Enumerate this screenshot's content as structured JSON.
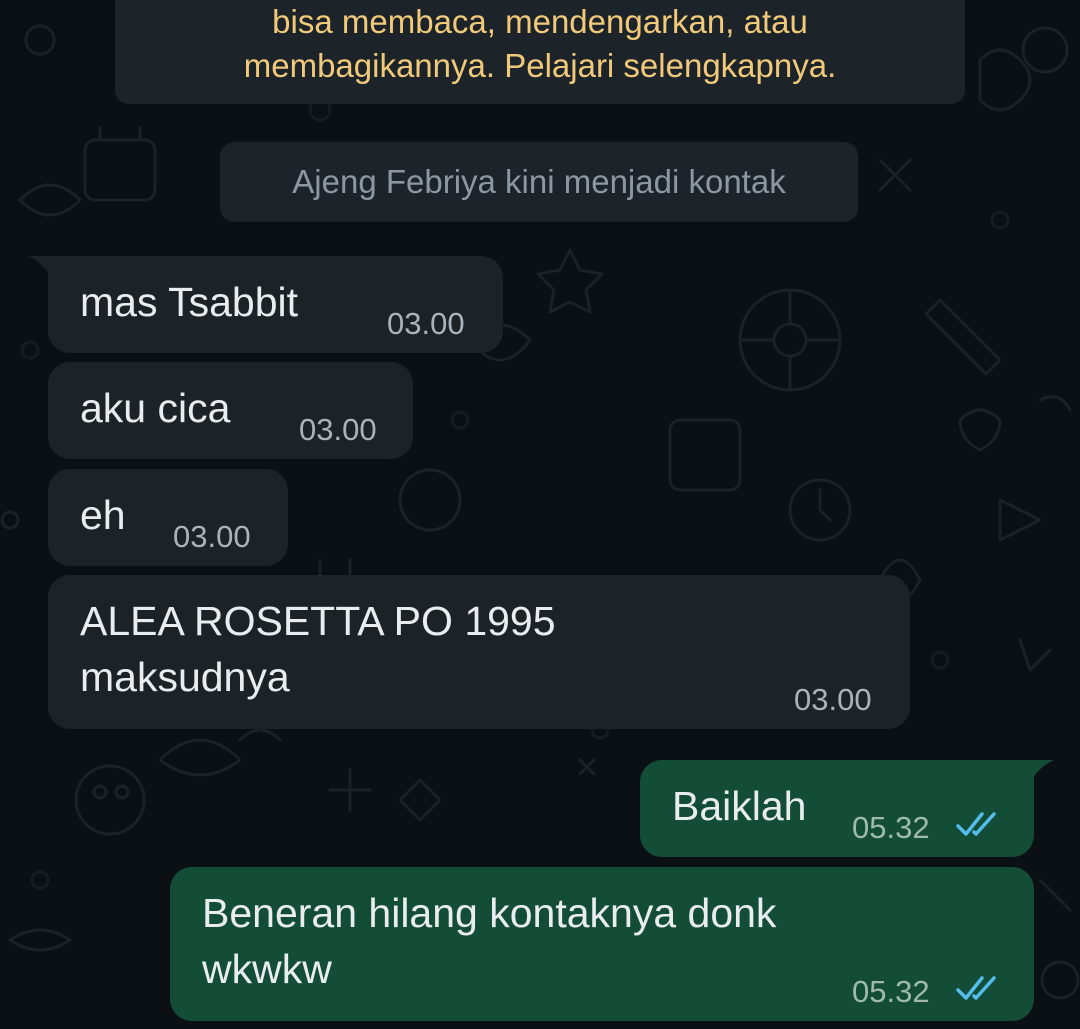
{
  "encryption_notice": {
    "line1": "bisa membaca, mendengarkan, atau",
    "line2": "membagikannya. Pelajari selengkapnya."
  },
  "system_message": "Ajeng Febriya kini menjadi kontak",
  "messages": [
    {
      "text": "mas Tsabbit",
      "time": "03.00",
      "direction": "incoming"
    },
    {
      "text": "aku cica",
      "time": "03.00",
      "direction": "incoming"
    },
    {
      "text": "eh",
      "time": "03.00",
      "direction": "incoming"
    },
    {
      "text_line1": "ALEA ROSETTA PO 1995",
      "text_line2": "maksudnya",
      "time": "03.00",
      "direction": "incoming"
    },
    {
      "text": "Baiklah",
      "time": "05.32",
      "direction": "outgoing",
      "status": "read"
    },
    {
      "text_line1": "Beneran hilang kontaknya donk",
      "text_line2": "wkwkw",
      "time": "05.32",
      "direction": "outgoing",
      "status": "read"
    }
  ],
  "colors": {
    "background": "#0b1014",
    "incoming_bubble": "#1d2226",
    "outgoing_bubble": "#144d37",
    "notice_text": "#f1c97a",
    "read_ticks": "#53bdeb"
  },
  "icons": {
    "read_receipt": "double-check-icon"
  }
}
